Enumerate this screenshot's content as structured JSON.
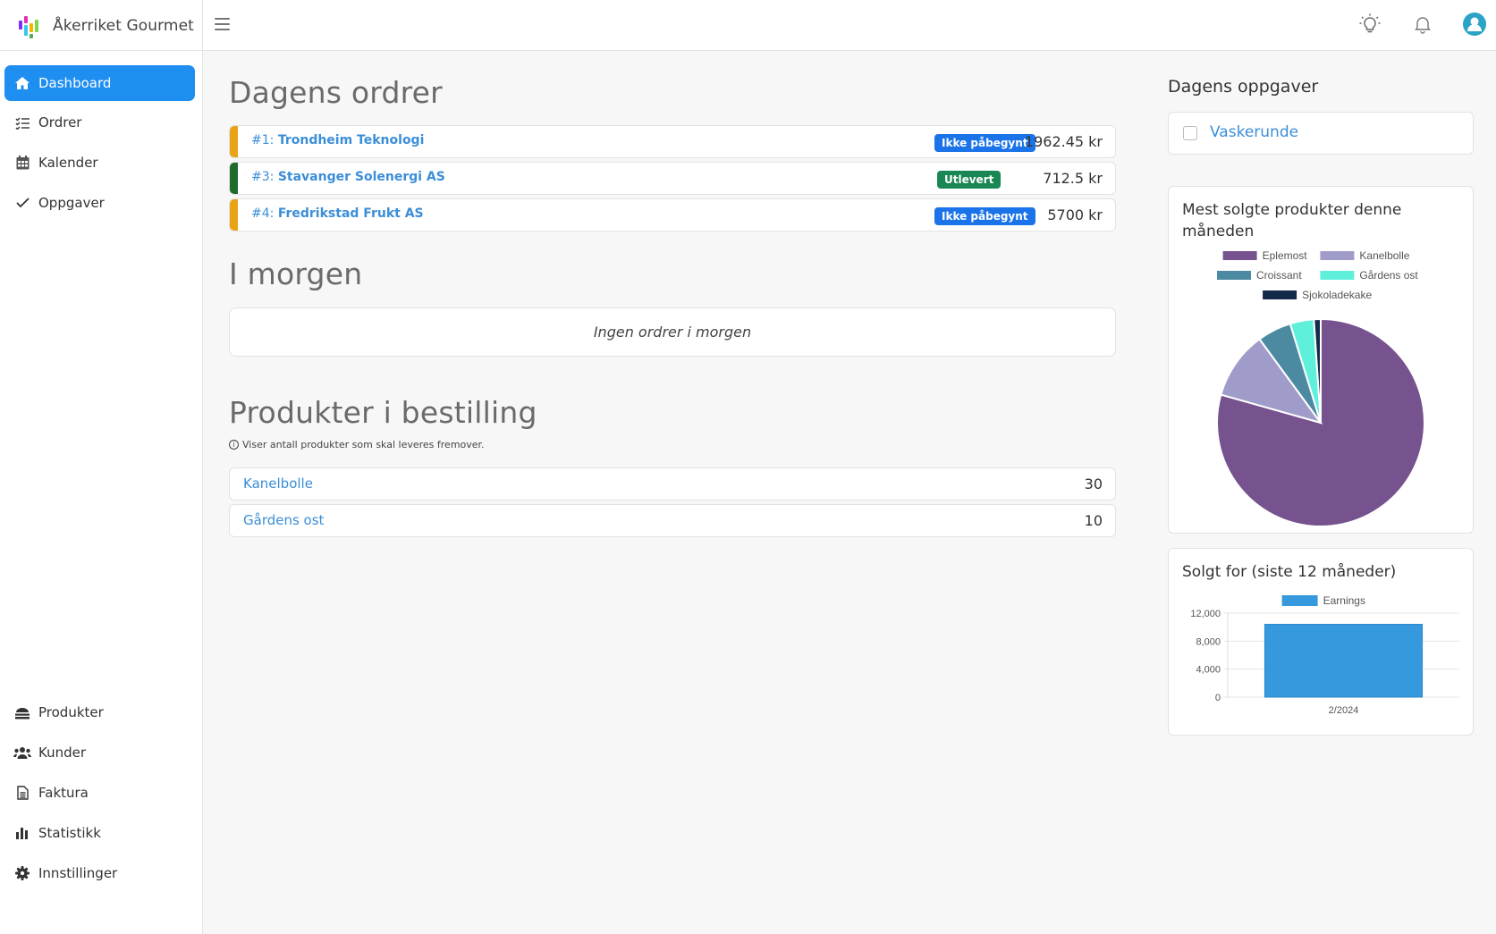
{
  "app": {
    "title": "Åkerriket Gourmet"
  },
  "sidebar": {
    "top_items": [
      {
        "label": "Dashboard",
        "icon": "home-icon",
        "active": true
      },
      {
        "label": "Ordrer",
        "icon": "list-check-icon"
      },
      {
        "label": "Kalender",
        "icon": "calendar-icon"
      },
      {
        "label": "Oppgaver",
        "icon": "check-icon"
      }
    ],
    "bottom_items": [
      {
        "label": "Produkter",
        "icon": "cake-icon"
      },
      {
        "label": "Kunder",
        "icon": "users-icon"
      },
      {
        "label": "Faktura",
        "icon": "invoice-icon"
      },
      {
        "label": "Statistikk",
        "icon": "bar-chart-icon"
      },
      {
        "label": "Innstillinger",
        "icon": "gear-icon"
      }
    ]
  },
  "topbar": {
    "icons": [
      "lightbulb-icon",
      "bell-icon",
      "user-avatar-icon"
    ]
  },
  "today": {
    "heading": "Dagens ordrer",
    "orders": [
      {
        "number": "#1:",
        "customer": "Trondheim Teknologi",
        "status": "Ikke påbegynt",
        "status_color": "#1a73e8",
        "stripe_color": "#e8a317",
        "amount": "1962.45 kr"
      },
      {
        "number": "#3:",
        "customer": "Stavanger Solenergi AS",
        "status": "Utlevert",
        "status_color": "#198754",
        "stripe_color": "#1e6b2a",
        "amount": "712.5 kr"
      },
      {
        "number": "#4:",
        "customer": "Fredrikstad Frukt AS",
        "status": "Ikke påbegynt",
        "status_color": "#1a73e8",
        "stripe_color": "#e8a317",
        "amount": "5700 kr"
      }
    ]
  },
  "tomorrow": {
    "heading": "I morgen",
    "empty_text": "Ingen ordrer i morgen"
  },
  "products": {
    "heading": "Produkter i bestilling",
    "info": "Viser antall produkter som skal leveres fremover.",
    "items": [
      {
        "name": "Kanelbolle",
        "count": "30"
      },
      {
        "name": "Gårdens ost",
        "count": "10"
      }
    ]
  },
  "tasks": {
    "heading": "Dagens oppgaver",
    "items": [
      {
        "label": "Vaskerunde",
        "checked": false
      }
    ]
  },
  "pie_card": {
    "title": "Mest solgte produkter denne måneden"
  },
  "bar_card": {
    "title": "Solgt for (siste 12 måneder)"
  },
  "chart_data": [
    {
      "type": "pie",
      "title": "Mest solgte produkter denne måneden",
      "legend_position": "top",
      "series": [
        {
          "name": "Eplemost",
          "value": 75,
          "color": "#76528e"
        },
        {
          "name": "Kanelbolle",
          "value": 10,
          "color": "#a09cc9"
        },
        {
          "name": "Croissant",
          "value": 5,
          "color": "#4b8aa0"
        },
        {
          "name": "Gårdens ost",
          "value": 3.5,
          "color": "#5ff0dc"
        },
        {
          "name": "Sjokoladekake",
          "value": 1,
          "color": "#142a4a"
        }
      ]
    },
    {
      "type": "bar",
      "title": "Solgt for (siste 12 måneder)",
      "legend_position": "top",
      "categories": [
        "2/2024"
      ],
      "series": [
        {
          "name": "Earnings",
          "values": [
            10400
          ],
          "color": "#3699dd"
        }
      ],
      "ylim": [
        0,
        12000
      ],
      "yticks": [
        0,
        4000,
        8000,
        12000
      ],
      "ytick_labels": [
        "0",
        "4,000",
        "8,000",
        "12,000"
      ],
      "grid": true
    }
  ]
}
